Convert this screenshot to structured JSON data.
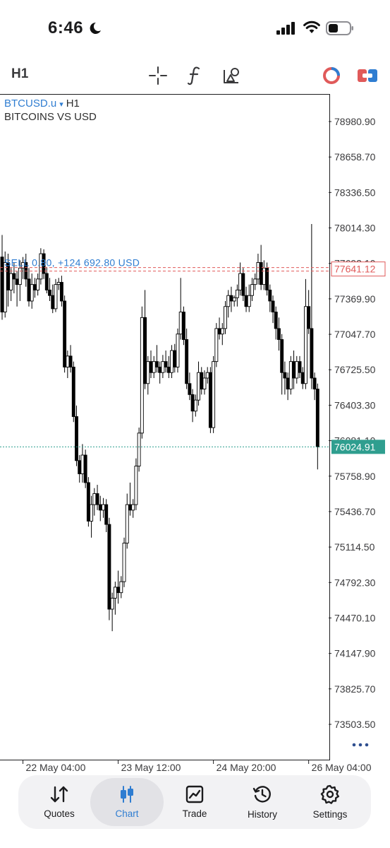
{
  "status_bar": {
    "time": "6:46",
    "icons": [
      "moon-icon",
      "cellular-signal-icon",
      "wifi-icon",
      "battery-icon"
    ]
  },
  "toolbar": {
    "timeframe": "H1",
    "tools": [
      "crosshair-icon",
      "indicator-f-icon",
      "drawing-objects-icon",
      "one-click-trading-icon",
      "trade-panel-icon"
    ]
  },
  "chart": {
    "symbol": "BTCUSD.u",
    "symbol_arrow": "▾",
    "timeframe": "H1",
    "description": "BITCOINS VS USD",
    "colors": {
      "sell_line": "#e05a5a",
      "bid_line": "#2f9e8f",
      "profit_text": "#2f7dd1",
      "candles": "#000000"
    }
  },
  "chart_data": {
    "type": "candlestick",
    "yticks": [
      "78980.90",
      "78658.70",
      "78336.50",
      "78014.30",
      "77692.10",
      "77369.90",
      "77047.70",
      "76725.50",
      "76403.30",
      "76081.10",
      "75758.90",
      "75436.70",
      "75114.50",
      "74792.30",
      "74470.10",
      "74147.90",
      "73825.70",
      "73503.50"
    ],
    "ylim": [
      73200,
      79300
    ],
    "xticks": [
      "22 May 04:00",
      "23 May 12:00",
      "24 May 20:00",
      "26 May 04:00"
    ],
    "xtick_index": [
      7,
      39,
      71,
      103
    ],
    "position": {
      "label": "SELL 0.80, +124 692.80 USD",
      "price": 77641.12,
      "price_label": "77641.12"
    },
    "bid": {
      "price": 76024.91,
      "price_label": "76024.91"
    },
    "candles": [
      [
        77750,
        77950,
        77180,
        77250
      ],
      [
        77250,
        77800,
        77200,
        77700
      ],
      [
        77700,
        77780,
        77300,
        77450
      ],
      [
        77450,
        77650,
        77350,
        77600
      ],
      [
        77600,
        77700,
        77420,
        77550
      ],
      [
        77550,
        77620,
        77300,
        77500
      ],
      [
        77500,
        77720,
        77350,
        77650
      ],
      [
        77650,
        77750,
        77550,
        77700
      ],
      [
        77700,
        77780,
        77480,
        77550
      ],
      [
        77550,
        77650,
        77300,
        77350
      ],
      [
        77350,
        77600,
        77280,
        77500
      ],
      [
        77500,
        77560,
        77380,
        77450
      ],
      [
        77450,
        77600,
        77400,
        77550
      ],
      [
        77550,
        77830,
        77500,
        77780
      ],
      [
        77780,
        77820,
        77550,
        77600
      ],
      [
        77600,
        77660,
        77420,
        77450
      ],
      [
        77450,
        77560,
        77350,
        77400
      ],
      [
        77400,
        77500,
        77240,
        77280
      ],
      [
        77280,
        77550,
        77250,
        77500
      ],
      [
        77500,
        77560,
        77450,
        77520
      ],
      [
        77520,
        77580,
        77300,
        77350
      ],
      [
        77350,
        77400,
        76700,
        76750
      ],
      [
        76750,
        76900,
        76650,
        76850
      ],
      [
        76850,
        76950,
        76700,
        76750
      ],
      [
        76750,
        76800,
        76250,
        76300
      ],
      [
        76300,
        76400,
        75850,
        75900
      ],
      [
        75900,
        75950,
        75700,
        75780
      ],
      [
        75780,
        76050,
        75700,
        75950
      ],
      [
        75950,
        76000,
        75650,
        75700
      ],
      [
        75700,
        75750,
        75300,
        75350
      ],
      [
        75350,
        75580,
        75200,
        75500
      ],
      [
        75500,
        75650,
        75400,
        75600
      ],
      [
        75600,
        75680,
        75450,
        75500
      ],
      [
        75500,
        75580,
        75350,
        75450
      ],
      [
        75450,
        75560,
        75380,
        75500
      ],
      [
        75500,
        75550,
        75250,
        75320
      ],
      [
        75320,
        75380,
        74450,
        74550
      ],
      [
        74550,
        74700,
        74350,
        74650
      ],
      [
        74650,
        74800,
        74500,
        74750
      ],
      [
        74750,
        74900,
        74600,
        74700
      ],
      [
        74700,
        74850,
        74650,
        74800
      ],
      [
        74800,
        75200,
        74750,
        75150
      ],
      [
        75150,
        75600,
        75100,
        75500
      ],
      [
        75500,
        75700,
        75400,
        75450
      ],
      [
        75450,
        75550,
        75380,
        75500
      ],
      [
        75500,
        75920,
        75450,
        75850
      ],
      [
        75850,
        76200,
        75800,
        76150
      ],
      [
        76150,
        77300,
        76100,
        77200
      ],
      [
        77200,
        77450,
        76550,
        76600
      ],
      [
        76600,
        76850,
        76500,
        76800
      ],
      [
        76800,
        76900,
        76650,
        76700
      ],
      [
        76700,
        76850,
        76650,
        76800
      ],
      [
        76800,
        76950,
        76700,
        76750
      ],
      [
        76750,
        76800,
        76600,
        76700
      ],
      [
        76700,
        76860,
        76650,
        76800
      ],
      [
        76800,
        76900,
        76700,
        76750
      ],
      [
        76750,
        76850,
        76650,
        76700
      ],
      [
        76700,
        76950,
        76650,
        76900
      ],
      [
        76900,
        76960,
        76700,
        76750
      ],
      [
        76750,
        77100,
        76700,
        77050
      ],
      [
        77050,
        77560,
        77000,
        77250
      ],
      [
        77250,
        77300,
        76950,
        77000
      ],
      [
        77000,
        77100,
        76550,
        76600
      ],
      [
        76600,
        76700,
        76450,
        76500
      ],
      [
        76500,
        76550,
        76250,
        76350
      ],
      [
        76350,
        76500,
        76300,
        76450
      ],
      [
        76450,
        76800,
        76400,
        76700
      ],
      [
        76700,
        76750,
        76500,
        76550
      ],
      [
        76550,
        76720,
        76500,
        76650
      ],
      [
        76650,
        76750,
        76600,
        76700
      ],
      [
        76700,
        76750,
        76150,
        76200
      ],
      [
        76200,
        76850,
        76150,
        76800
      ],
      [
        76800,
        77150,
        76750,
        77100
      ],
      [
        77100,
        77200,
        77000,
        77050
      ],
      [
        77050,
        77150,
        76950,
        77100
      ],
      [
        77100,
        77350,
        77050,
        77300
      ],
      [
        77300,
        77450,
        77200,
        77400
      ],
      [
        77400,
        77480,
        77250,
        77350
      ],
      [
        77350,
        77400,
        77300,
        77380
      ],
      [
        77380,
        77500,
        77300,
        77450
      ],
      [
        77450,
        77700,
        77400,
        77600
      ],
      [
        77600,
        77650,
        77350,
        77400
      ],
      [
        77400,
        77480,
        77250,
        77300
      ],
      [
        77300,
        77500,
        77250,
        77400
      ],
      [
        77400,
        77560,
        77350,
        77500
      ],
      [
        77500,
        77600,
        77450,
        77550
      ],
      [
        77550,
        77780,
        77500,
        77700
      ],
      [
        77700,
        77860,
        77450,
        77500
      ],
      [
        77500,
        77720,
        77450,
        77650
      ],
      [
        77650,
        77700,
        77400,
        77450
      ],
      [
        77450,
        77500,
        77250,
        77350
      ],
      [
        77350,
        77400,
        77150,
        77250
      ],
      [
        77250,
        77300,
        77000,
        77100
      ],
      [
        77100,
        77200,
        76900,
        77000
      ],
      [
        77000,
        77050,
        76500,
        76700
      ],
      [
        76700,
        76800,
        76500,
        76650
      ],
      [
        76650,
        76700,
        76450,
        76550
      ],
      [
        76550,
        76850,
        76500,
        76800
      ],
      [
        76800,
        76900,
        76550,
        76650
      ],
      [
        76650,
        76850,
        76600,
        76800
      ],
      [
        76800,
        76850,
        76650,
        76700
      ],
      [
        76700,
        76750,
        76550,
        76600
      ],
      [
        76600,
        77550,
        76550,
        77300
      ],
      [
        77300,
        77450,
        77050,
        77100
      ],
      [
        77100,
        78050,
        76550,
        76650
      ],
      [
        76650,
        76700,
        76450,
        76550
      ],
      [
        76550,
        76600,
        75820,
        76025
      ]
    ]
  },
  "tabs": [
    {
      "label": "Quotes",
      "icon": "quotes-arrows-icon",
      "active": false
    },
    {
      "label": "Chart",
      "icon": "candlestick-icon",
      "active": true
    },
    {
      "label": "Trade",
      "icon": "trade-chart-icon",
      "active": false
    },
    {
      "label": "History",
      "icon": "history-clock-icon",
      "active": false
    },
    {
      "label": "Settings",
      "icon": "gear-icon",
      "active": false
    }
  ]
}
